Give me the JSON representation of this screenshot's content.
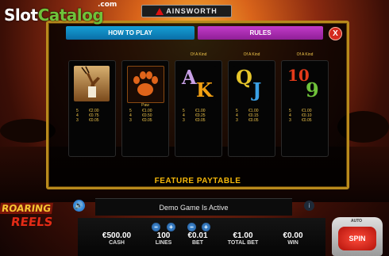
{
  "watermark": {
    "slot": "Slot",
    "catalog": "Catalog",
    "com": ".com"
  },
  "brand": {
    "name": "AINSWORTH"
  },
  "tabs": {
    "how_to_play": "HOW TO PLAY",
    "rules": "RULES"
  },
  "close_label": "X",
  "paytable": {
    "cards": [
      {
        "header": "",
        "symbol": "gazelle-symbol",
        "label": "",
        "pays": [
          {
            "n": "5",
            "v": "€2.00"
          },
          {
            "n": "4",
            "v": "€0.75"
          },
          {
            "n": "3",
            "v": "€0.05"
          }
        ]
      },
      {
        "header": "",
        "symbol": "paw-symbol",
        "label": "Paw",
        "pays": [
          {
            "n": "5",
            "v": "€1.00"
          },
          {
            "n": "4",
            "v": "€0.50"
          },
          {
            "n": "3",
            "v": "€0.05"
          }
        ]
      },
      {
        "header": "Of A Kind",
        "symbol": "ace-king-symbol",
        "label": "",
        "pays": [
          {
            "n": "5",
            "v": "€1.00"
          },
          {
            "n": "4",
            "v": "€0.25"
          },
          {
            "n": "3",
            "v": "€0.05"
          }
        ]
      },
      {
        "header": "Of A Kind",
        "symbol": "queen-jack-symbol",
        "label": "",
        "pays": [
          {
            "n": "5",
            "v": "€1.00"
          },
          {
            "n": "4",
            "v": "€0.15"
          },
          {
            "n": "3",
            "v": "€0.05"
          }
        ]
      },
      {
        "header": "Of A Kind",
        "symbol": "ten-nine-symbol",
        "label": "",
        "pays": [
          {
            "n": "5",
            "v": "€1.00"
          },
          {
            "n": "4",
            "v": "€0.10"
          },
          {
            "n": "3",
            "v": "€0.05"
          }
        ]
      }
    ],
    "letters": {
      "a": "A",
      "k": "K",
      "q": "Q",
      "j": "J",
      "ten": "10",
      "nine": "9"
    },
    "title": "FEATURE PAYTABLE"
  },
  "game_logo": {
    "line1": "ROARING",
    "line2": "REELS"
  },
  "message": "Demo Game Is Active",
  "info_label": "i",
  "stats": {
    "cash": {
      "value": "€500.00",
      "label": "CASH"
    },
    "lines": {
      "value": "100",
      "label": "LINES"
    },
    "bet": {
      "value": "€0.01",
      "label": "BET"
    },
    "total_bet": {
      "value": "€1.00",
      "label": "TOTAL BET"
    },
    "win": {
      "value": "€0.00",
      "label": "WIN"
    }
  },
  "stepper": {
    "minus": "−",
    "plus": "+"
  },
  "spin": {
    "label": "SPIN",
    "auto": "AUTO"
  }
}
